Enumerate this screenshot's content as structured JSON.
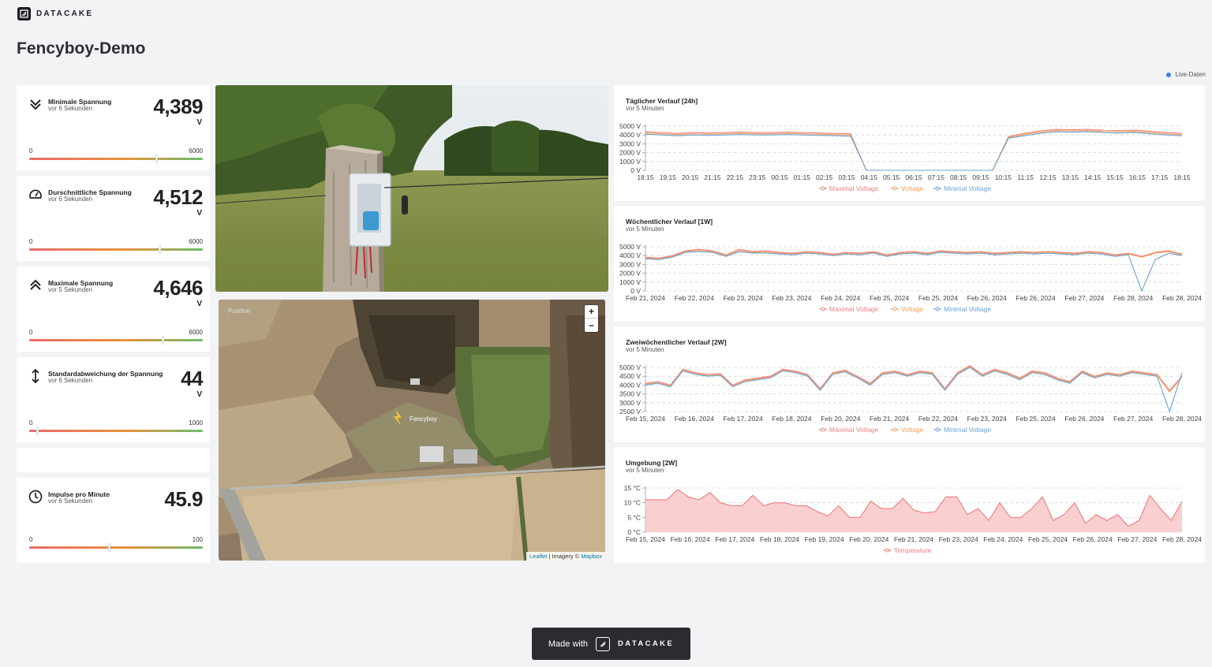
{
  "brand": {
    "name": "DATACAKE"
  },
  "page": {
    "title": "Fencyboy-Demo"
  },
  "live": {
    "label": "Live-Daten",
    "color": "#3b82f6"
  },
  "kpis": [
    {
      "id": "min-voltage",
      "icon": "chevrons-down-icon",
      "label": "Minimale Spannung",
      "sub": "vor 6 Sekunden",
      "value": "4,389",
      "unit": "V",
      "min": "0",
      "max": "6000",
      "fraction": 0.73
    },
    {
      "id": "avg-voltage",
      "icon": "gauge-icon",
      "label": "Durschnittliche Spannung",
      "sub": "vor 6 Sekunden",
      "value": "4,512",
      "unit": "V",
      "min": "0",
      "max": "6000",
      "fraction": 0.75
    },
    {
      "id": "max-voltage",
      "icon": "chevrons-up-icon",
      "label": "Maximale Spannung",
      "sub": "vor 5 Sekunden",
      "value": "4,646",
      "unit": "V",
      "min": "0",
      "max": "6000",
      "fraction": 0.77
    },
    {
      "id": "stddev-voltage",
      "icon": "arrows-vertical-icon",
      "label": "Standardabweichung der Spannung",
      "sub": "vor 6 Sekunden",
      "value": "44",
      "unit": "V",
      "min": "0",
      "max": "1000",
      "fraction": 0.044
    },
    {
      "id": "impulses",
      "icon": "clock-icon",
      "label": "Impulse pro Minute",
      "sub": "vor 6 Sekunden",
      "value": "45.9",
      "unit": "",
      "min": "0",
      "max": "100",
      "fraction": 0.459
    }
  ],
  "map": {
    "label": "Position",
    "marker_label": "Fencyboy",
    "zoom_in": "+",
    "zoom_out": "−",
    "attribution_link": "Leaflet",
    "attribution_text": " | Imagery © ",
    "attribution_provider": "Mapbox"
  },
  "colors": {
    "maximal": "#f08080",
    "voltage": "#f0a05a",
    "minimal": "#6aa3d8",
    "temperature": "#f07c7c",
    "temperature_fill": "#f9c7c7",
    "gauge_red": "#e86a6a",
    "gauge_orange": "#e8923a",
    "gauge_green": "#6dbb6d"
  },
  "chart_data": [
    {
      "type": "line",
      "title": "Täglicher Verlauf [24h]",
      "subtitle": "vor 5 Minuten",
      "y_ticks": [
        "5000 V",
        "4000 V",
        "3000 V",
        "2000 V",
        "1000 V",
        "0 V"
      ],
      "ylim": [
        0,
        5500
      ],
      "x_ticks": [
        "18:15",
        "19:15",
        "20:15",
        "21:15",
        "22:15",
        "23:15",
        "00:15",
        "01:15",
        "02:15",
        "03:15",
        "04:15",
        "05:15",
        "06:15",
        "07:15",
        "08:15",
        "09:15",
        "10:15",
        "11:15",
        "12:15",
        "13:15",
        "14:15",
        "15:15",
        "16:15",
        "17:15",
        "18:15"
      ],
      "legend": [
        "Maximal Voltage",
        "Voltage",
        "Minimal Voltage"
      ],
      "series": [
        {
          "name": "Maximal Voltage",
          "values": [
            4800,
            4700,
            4600,
            4700,
            4650,
            4700,
            4750,
            4700,
            4700,
            4750,
            4700,
            4650,
            4600,
            4550,
            0,
            0,
            0,
            0,
            0,
            0,
            0,
            0,
            0,
            4200,
            4600,
            4900,
            5100,
            5050,
            5100,
            5000,
            4950,
            5000,
            4850,
            4700,
            4600
          ]
        },
        {
          "name": "Voltage",
          "values": [
            4650,
            4550,
            4450,
            4550,
            4500,
            4550,
            4600,
            4550,
            4550,
            4600,
            4550,
            4500,
            4450,
            4400,
            0,
            0,
            0,
            0,
            0,
            0,
            0,
            0,
            0,
            4100,
            4450,
            4750,
            4950,
            4900,
            4950,
            4850,
            4800,
            4850,
            4700,
            4550,
            4450
          ]
        },
        {
          "name": "Minimal Voltage",
          "values": [
            4500,
            4400,
            4300,
            4400,
            4350,
            4400,
            4450,
            4400,
            4400,
            4450,
            4400,
            4350,
            4300,
            4250,
            0,
            0,
            0,
            0,
            0,
            0,
            0,
            0,
            0,
            4000,
            4300,
            4600,
            4800,
            4750,
            4800,
            4700,
            4650,
            4700,
            4550,
            4400,
            4300
          ]
        }
      ]
    },
    {
      "type": "line",
      "title": "Wöchentlicher Verlauf [1W]",
      "subtitle": "vor 5 Minuten",
      "y_ticks": [
        "5000 V",
        "4000 V",
        "3000 V",
        "2000 V",
        "1000 V",
        "0 V"
      ],
      "ylim": [
        0,
        5500
      ],
      "x_ticks": [
        "Feb 21, 2024",
        "Feb 22, 2024",
        "Feb 23, 2024",
        "Feb 23, 2024",
        "Feb 24, 2024",
        "Feb 25, 2024",
        "Feb 25, 2024",
        "Feb 26, 2024",
        "Feb 26, 2024",
        "Feb 27, 2024",
        "Feb 28, 2024",
        "Feb 28, 2024"
      ],
      "legend": [
        "Maximal Voltage",
        "Voltage",
        "Minimal Voltage"
      ],
      "series": [
        {
          "name": "Maximal Voltage",
          "values": [
            4200,
            4100,
            4400,
            5000,
            5200,
            5000,
            4500,
            5200,
            4900,
            5000,
            4800,
            4700,
            4900,
            4800,
            4600,
            4800,
            4700,
            4900,
            4500,
            4800,
            4900,
            4700,
            5000,
            4900,
            4800,
            4900,
            4700,
            4800,
            4900,
            4800,
            4900,
            4800,
            4700,
            4900,
            4800,
            4500,
            4700,
            4300,
            4800,
            5000,
            4600
          ]
        },
        {
          "name": "Voltage",
          "values": [
            4100,
            4000,
            4300,
            4900,
            5050,
            4900,
            4400,
            5050,
            4800,
            4850,
            4700,
            4600,
            4800,
            4700,
            4500,
            4700,
            4600,
            4800,
            4400,
            4700,
            4800,
            4600,
            4900,
            4800,
            4700,
            4800,
            4600,
            4700,
            4800,
            4700,
            4800,
            4700,
            4600,
            4800,
            4700,
            4400,
            4600,
            4200,
            4700,
            4900,
            4500
          ]
        },
        {
          "name": "Minimal Voltage",
          "values": [
            4000,
            3900,
            4200,
            4800,
            4900,
            4800,
            4300,
            4900,
            4700,
            4700,
            4600,
            4500,
            4700,
            4600,
            4400,
            4600,
            4500,
            4700,
            4300,
            4600,
            4700,
            4500,
            4800,
            4700,
            4600,
            4700,
            4500,
            4600,
            4700,
            4600,
            4700,
            4600,
            4500,
            4700,
            4600,
            4300,
            4500,
            0,
            3900,
            4700,
            4400
          ]
        }
      ]
    },
    {
      "type": "line",
      "title": "Zweiwöchentlicher Verlauf [2W]",
      "subtitle": "vor 5 Minuten",
      "y_ticks": [
        "5000 V",
        "4500 V",
        "4000 V",
        "3500 V",
        "3000 V",
        "2500 V"
      ],
      "ylim": [
        2500,
        5000
      ],
      "x_ticks": [
        "Feb 15, 2024",
        "Feb 16, 2024",
        "Feb 17, 2024",
        "Feb 18, 2024",
        "Feb 20, 2024",
        "Feb 21, 2024",
        "Feb 22, 2024",
        "Feb 23, 2024",
        "Feb 25, 2024",
        "Feb 26, 2024",
        "Feb 27, 2024",
        "Feb 28, 2024"
      ],
      "legend": [
        "Maximal Voltage",
        "Voltage",
        "Minimal Voltage"
      ],
      "series": [
        {
          "name": "Maximal Voltage",
          "values": [
            4100,
            4200,
            4000,
            4900,
            4700,
            4600,
            4650,
            4000,
            4300,
            4400,
            4500,
            4900,
            4800,
            4600,
            3800,
            4700,
            4850,
            4500,
            4100,
            4700,
            4800,
            4600,
            4800,
            4700,
            3800,
            4700,
            5100,
            4600,
            4900,
            4700,
            4400,
            4800,
            4700,
            4400,
            4200,
            4800,
            4500,
            4700,
            4600,
            4800,
            4700,
            4600,
            3700,
            4500
          ]
        },
        {
          "name": "Voltage",
          "values": [
            4050,
            4150,
            3950,
            4850,
            4650,
            4550,
            4600,
            3950,
            4250,
            4350,
            4450,
            4850,
            4750,
            4550,
            3750,
            4650,
            4800,
            4450,
            4050,
            4650,
            4750,
            4550,
            4750,
            4650,
            3750,
            4650,
            5050,
            4550,
            4850,
            4650,
            4350,
            4750,
            4650,
            4350,
            4150,
            4750,
            4450,
            4650,
            4550,
            4750,
            4650,
            4550,
            3600,
            4450
          ]
        },
        {
          "name": "Minimal Voltage",
          "values": [
            4000,
            4100,
            3900,
            4800,
            4600,
            4500,
            4550,
            3900,
            4200,
            4300,
            4400,
            4800,
            4700,
            4500,
            3700,
            4600,
            4750,
            4400,
            4000,
            4600,
            4700,
            4500,
            4700,
            4600,
            3700,
            4600,
            5000,
            4500,
            4800,
            4600,
            4300,
            4700,
            4600,
            4300,
            4100,
            4700,
            4400,
            4600,
            4500,
            4700,
            4600,
            4500,
            2500,
            4700
          ]
        }
      ]
    },
    {
      "type": "area",
      "title": "Umgebung [2W]",
      "subtitle": "vor 5 Minuten",
      "y_ticks": [
        "15 °C",
        "10 °C",
        "5 °C",
        "0 °C"
      ],
      "ylim": [
        0,
        15
      ],
      "x_ticks": [
        "Feb 15, 2024",
        "Feb 16, 2024",
        "Feb 17, 2024",
        "Feb 18, 2024",
        "Feb 19, 2024",
        "Feb 20, 2024",
        "Feb 21, 2024",
        "Feb 23, 2024",
        "Feb 24, 2024",
        "Feb 25, 2024",
        "Feb 26, 2024",
        "Feb 27, 2024",
        "Feb 28, 2024"
      ],
      "legend": [
        "Temperature"
      ],
      "series": [
        {
          "name": "Temperature",
          "values": [
            11,
            11,
            11,
            14.5,
            12,
            11,
            13.5,
            10,
            9,
            9,
            12.5,
            9,
            10,
            10,
            9,
            9,
            7,
            5.5,
            9,
            5,
            5,
            10.5,
            8,
            8,
            11.5,
            7.5,
            6.5,
            7,
            12,
            12,
            6,
            8,
            4,
            10,
            5,
            5,
            8,
            12,
            4,
            6,
            10,
            3,
            6,
            4,
            6,
            2,
            4,
            12.5,
            8,
            4,
            10.5
          ]
        }
      ]
    }
  ]
}
